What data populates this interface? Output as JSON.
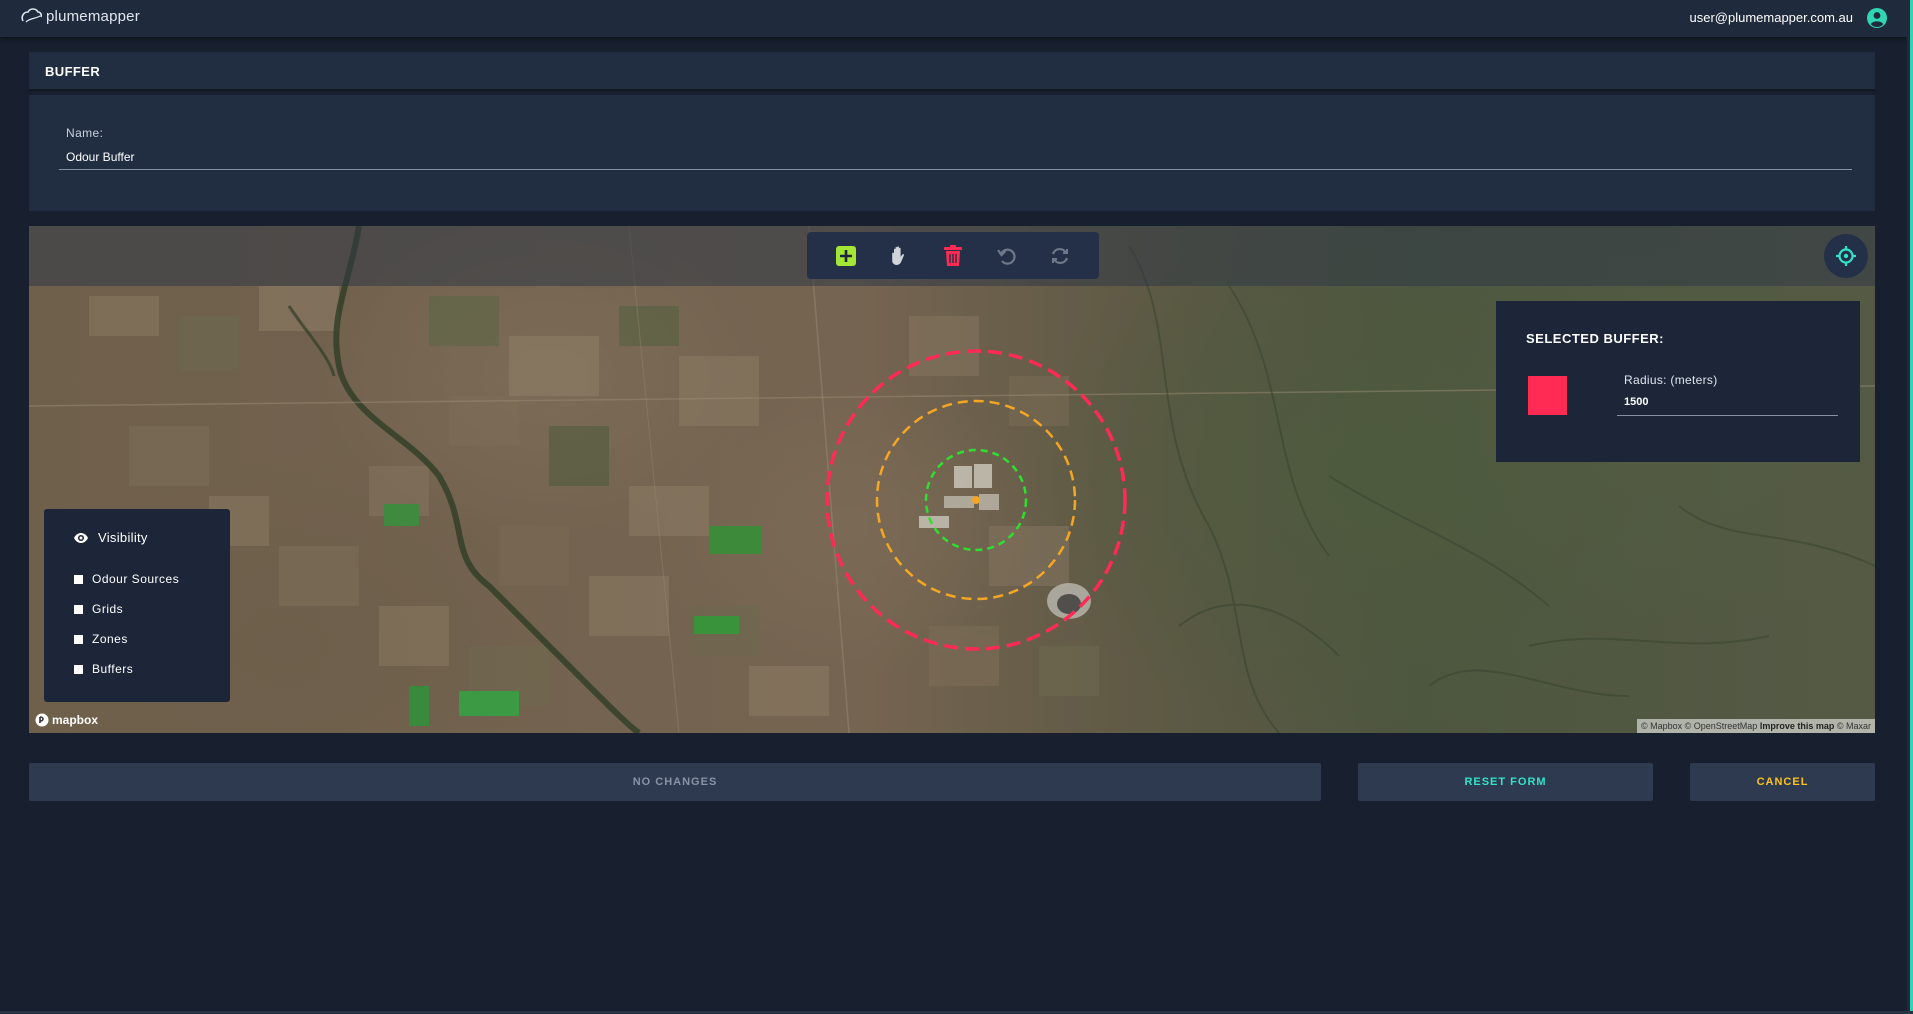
{
  "app": {
    "logo_text": "plumemapper",
    "user_email": "user@plumemapper.com.au"
  },
  "section": {
    "title": "BUFFER"
  },
  "form": {
    "name_label": "Name:",
    "name_value": "Odour Buffer"
  },
  "map": {
    "toolbar": {
      "add_icon": "add-square-icon",
      "pan_icon": "hand-pan-icon",
      "delete_icon": "trash-icon",
      "undo_icon": "undo-icon",
      "redo_icon": "redo-icon"
    },
    "locate_icon": "crosshair-icon",
    "selected_buffer": {
      "title": "SELECTED BUFFER:",
      "swatch_color": "#ff2b55",
      "radius_label": "Radius: (meters)",
      "radius_value": "1500"
    },
    "buffers": [
      {
        "color": "#ff2b55",
        "style": "dashed"
      },
      {
        "color": "#f5a623",
        "style": "dashed"
      },
      {
        "color": "#2ee02e",
        "style": "dashed"
      }
    ],
    "center_marker_color": "#f5a623",
    "visibility": {
      "title": "Visibility",
      "items": [
        {
          "label": "Odour Sources",
          "checked": false
        },
        {
          "label": "Grids",
          "checked": false
        },
        {
          "label": "Zones",
          "checked": false
        },
        {
          "label": "Buffers",
          "checked": false
        }
      ]
    },
    "mapbox_label": "mapbox",
    "attribution": {
      "mapbox": "© Mapbox",
      "osm": "© OpenStreetMap",
      "improve": "Improve this map",
      "maxar": "© Maxar"
    }
  },
  "buttons": {
    "no_changes": "NO CHANGES",
    "reset_form": "RESET FORM",
    "cancel": "CANCEL"
  },
  "colors": {
    "accent_teal": "#33e3c9",
    "accent_yellow": "#ffc21a",
    "add_green": "#a3e635",
    "delete_red": "#ff2b55"
  }
}
